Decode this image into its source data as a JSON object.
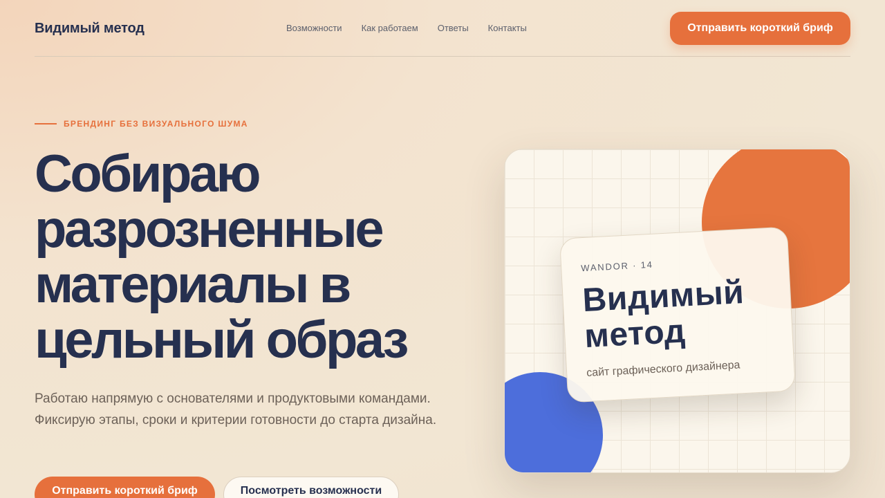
{
  "header": {
    "brand": "Видимый метод",
    "nav": [
      {
        "label": "Возможности"
      },
      {
        "label": "Как работаем"
      },
      {
        "label": "Ответы"
      },
      {
        "label": "Контакты"
      }
    ],
    "cta_label": "Отправить короткий бриф"
  },
  "hero": {
    "eyebrow": "БРЕНДИНГ БЕЗ ВИЗУАЛЬНОГО ШУМА",
    "title_lines": [
      "Собираю",
      "разрозненные",
      "материалы в",
      "цельный образ"
    ],
    "subtitle": "Работаю напрямую с основателями и продуктовыми командами. Фиксирую этапы, сроки и критерии готовности до старта дизайна.",
    "primary_button": "Отправить короткий бриф",
    "secondary_button": "Посмотреть возможности"
  },
  "showcase": {
    "meta": "WANDOR · 14",
    "title_lines": [
      "Видимый",
      "метод"
    ],
    "subtitle": "сайт графического дизайнера"
  },
  "colors": {
    "accent": "#e6703c",
    "ink": "#26304f",
    "blue": "#4d6edb",
    "background": "#f2e6d3"
  }
}
